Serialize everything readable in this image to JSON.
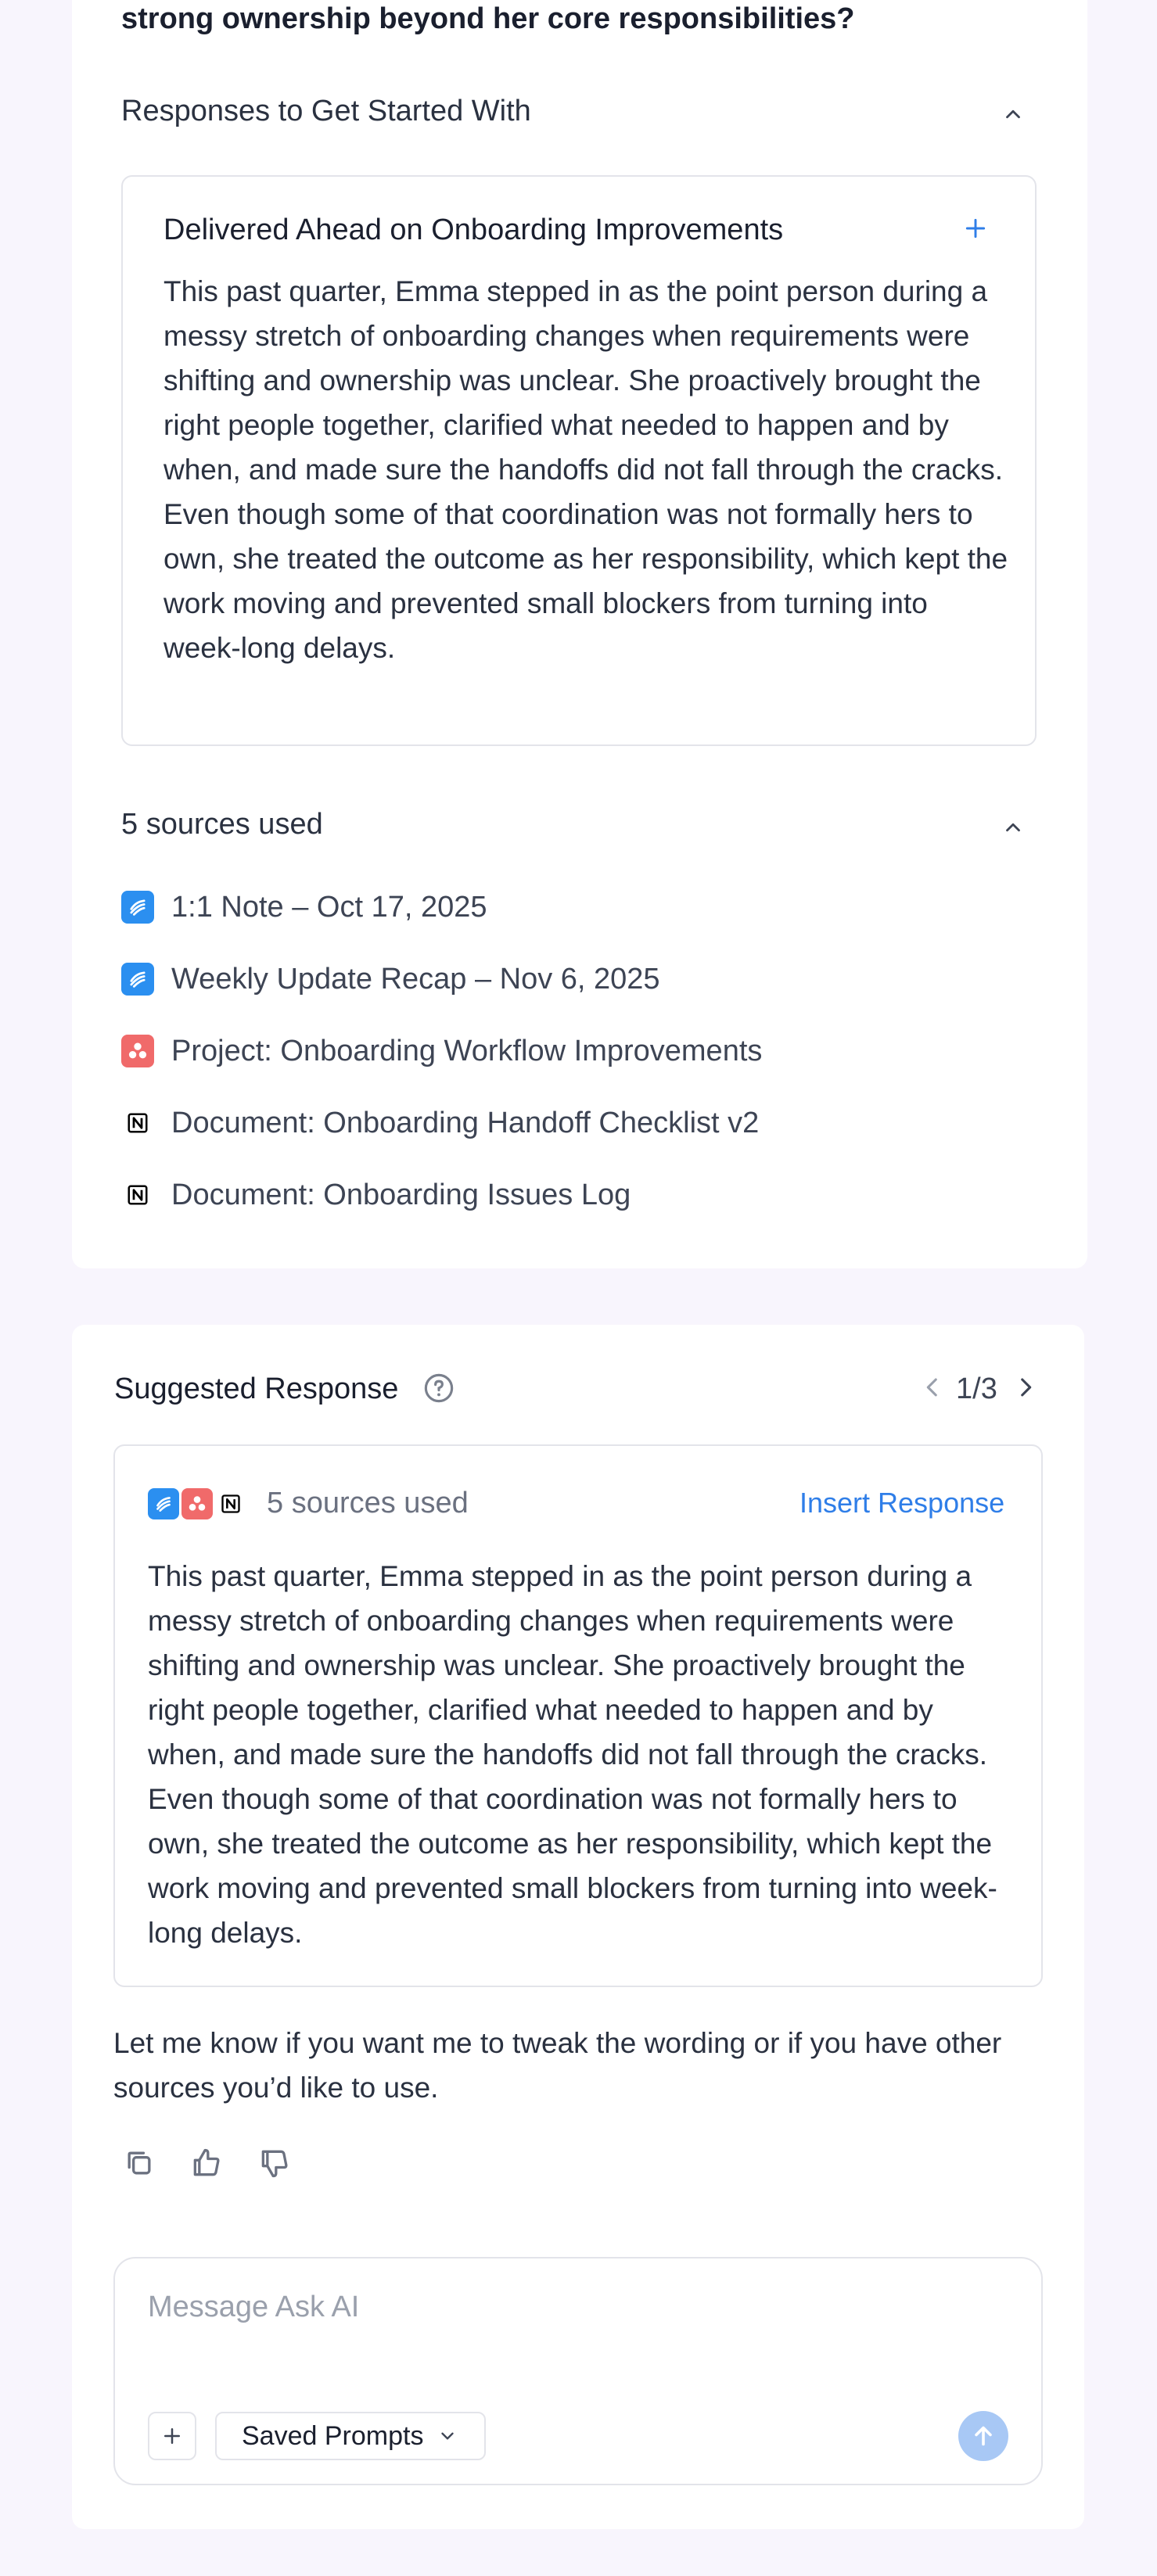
{
  "question": {
    "tail": "strong ownership beyond her core responsibilities?"
  },
  "responses_section": {
    "title": "Responses to Get Started With",
    "response": {
      "title": "Delivered Ahead on Onboarding Improvements",
      "body": "This past quarter, Emma stepped in as the point person during a messy stretch of onboarding changes when requirements were shifting and ownership was unclear. She proactively brought the right people together, clarified what needed to happen and by when, and made sure the handoffs did not fall through the cracks. Even though some of that coordination was not formally hers to own, she treated the outcome as her responsibility, which kept the work moving and prevented small blockers from turning into week-long delays."
    }
  },
  "sources_section": {
    "title": "5 sources used",
    "items": [
      {
        "label": "1:1 Note – Oct 17, 2025",
        "icon": "lattice-icon",
        "color": "#2b8ff0"
      },
      {
        "label": "Weekly Update Recap – Nov 6, 2025",
        "icon": "lattice-icon",
        "color": "#2b8ff0"
      },
      {
        "label": "Project: Onboarding Workflow Improvements",
        "icon": "asana-icon",
        "color": "#f06a6a"
      },
      {
        "label": "Document: Onboarding Handoff Checklist v2",
        "icon": "notion-icon",
        "color": "#000000"
      },
      {
        "label": "Document: Onboarding Issues Log",
        "icon": "notion-icon",
        "color": "#000000"
      }
    ]
  },
  "suggested": {
    "title": "Suggested Response",
    "pager": "1/3",
    "sources_label": "5 sources used",
    "insert_label": "Insert Response",
    "body": "This past quarter, Emma stepped in as the point person during a messy stretch of onboarding changes when requirements were shifting and ownership was unclear. She proactively brought the right people together, clarified what needed to happen and by when, and made sure the handoffs did not fall through the cracks. Even though some of that coordination was not formally hers to own, she treated the outcome as her responsibility, which kept the work moving and prevented small blockers from turning into week-long delays.",
    "followup": "Let me know if you want me to tweak the wording or if you have other sources you’d like to use."
  },
  "composer": {
    "placeholder": "Message Ask AI",
    "saved_prompts_label": "Saved Prompts"
  },
  "colors": {
    "accent": "#2f7ee8",
    "send_button": "#a8c8f5",
    "page_background": "#f8f5fd"
  }
}
